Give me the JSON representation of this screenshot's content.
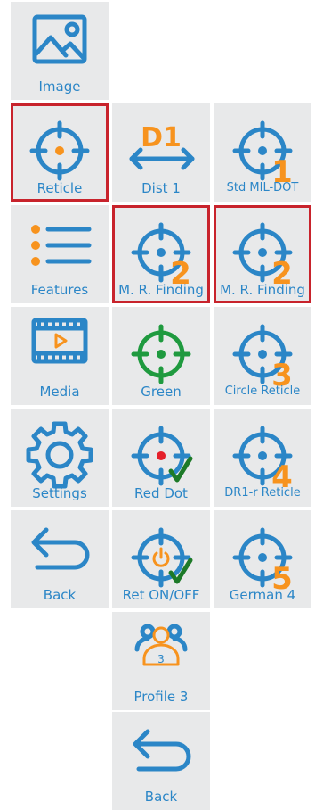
{
  "colors": {
    "tile_bg": "#e8e9ea",
    "icon_blue": "#2b86c7",
    "accent_orange": "#f7931e",
    "selected_border": "#c8232c",
    "green": "#1f9a3f",
    "red_dot": "#e5202a",
    "check_green": "#1d7a28"
  },
  "menu": {
    "col1": {
      "image": {
        "label": "Image",
        "icon": "image-icon"
      },
      "reticle": {
        "label": "Reticle",
        "icon": "crosshair-icon",
        "selected": true
      },
      "features": {
        "label": "Features",
        "icon": "list-icon"
      },
      "media": {
        "label": "Media",
        "icon": "film-icon"
      },
      "settings": {
        "label": "Settings",
        "icon": "gear-icon"
      },
      "back": {
        "label": "Back",
        "icon": "back-arrow-icon"
      }
    },
    "col2": {
      "dist1": {
        "label": "Dist 1",
        "badge": "D1",
        "icon": "distance-arrow-icon"
      },
      "mr_finding": {
        "label": "M. R. Finding",
        "badge": "2",
        "icon": "crosshair-icon",
        "selected": true
      },
      "green": {
        "label": "Green",
        "icon": "crosshair-icon"
      },
      "red_dot": {
        "label": "Red Dot",
        "icon": "crosshair-icon",
        "checked": true
      },
      "ret_onoff": {
        "label": "Ret ON/OFF",
        "icon": "power-crosshair-icon",
        "checked": true
      },
      "profile3": {
        "label": "Profile 3",
        "badge": "3",
        "icon": "users-icon"
      },
      "back": {
        "label": "Back",
        "icon": "back-arrow-icon"
      }
    },
    "col3": {
      "std_mildot": {
        "label": "Std MIL-DOT",
        "badge": "1",
        "icon": "crosshair-icon"
      },
      "mr_finding": {
        "label": "M. R. Finding",
        "badge": "2",
        "icon": "crosshair-icon",
        "selected": true
      },
      "circle_reticle": {
        "label": "Circle Reticle",
        "badge": "3",
        "icon": "crosshair-icon"
      },
      "dr1r_reticle": {
        "label": "DR1-r Reticle",
        "badge": "4",
        "icon": "crosshair-icon"
      },
      "german4": {
        "label": "German 4",
        "badge": "5",
        "icon": "crosshair-icon"
      }
    }
  }
}
